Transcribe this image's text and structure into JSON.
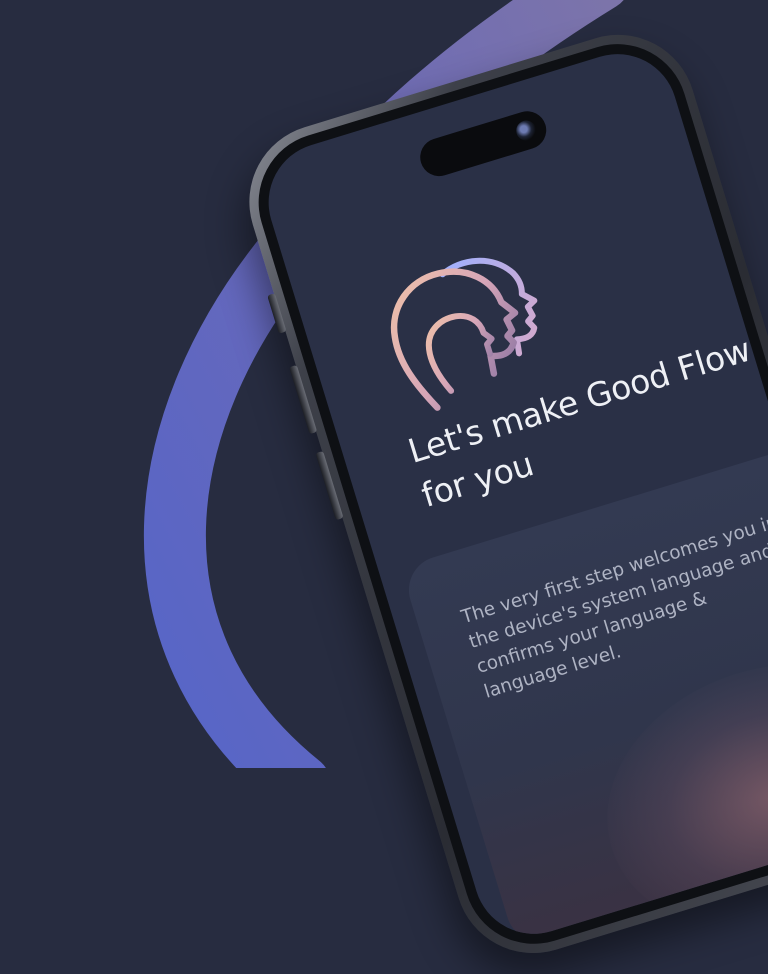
{
  "screen": {
    "headline": "Let's make Good Flow for you",
    "description": "The very first step welcomes you in the device's system language and confirms your language & language level."
  },
  "icons": {
    "logo": "two-heads-profile-logo",
    "camera": "front-camera-icon"
  },
  "colors": {
    "background": "#272c40",
    "screen": "#2a3046",
    "card": "#333a52",
    "headline_text": "#eef0f5",
    "body_text": "#aeb3c3",
    "logo_gradient": [
      "#e8b8a4",
      "#c9a7d8",
      "#8fa2f2"
    ],
    "ring_gradient": [
      "#5866c6",
      "#7a74b2"
    ]
  }
}
